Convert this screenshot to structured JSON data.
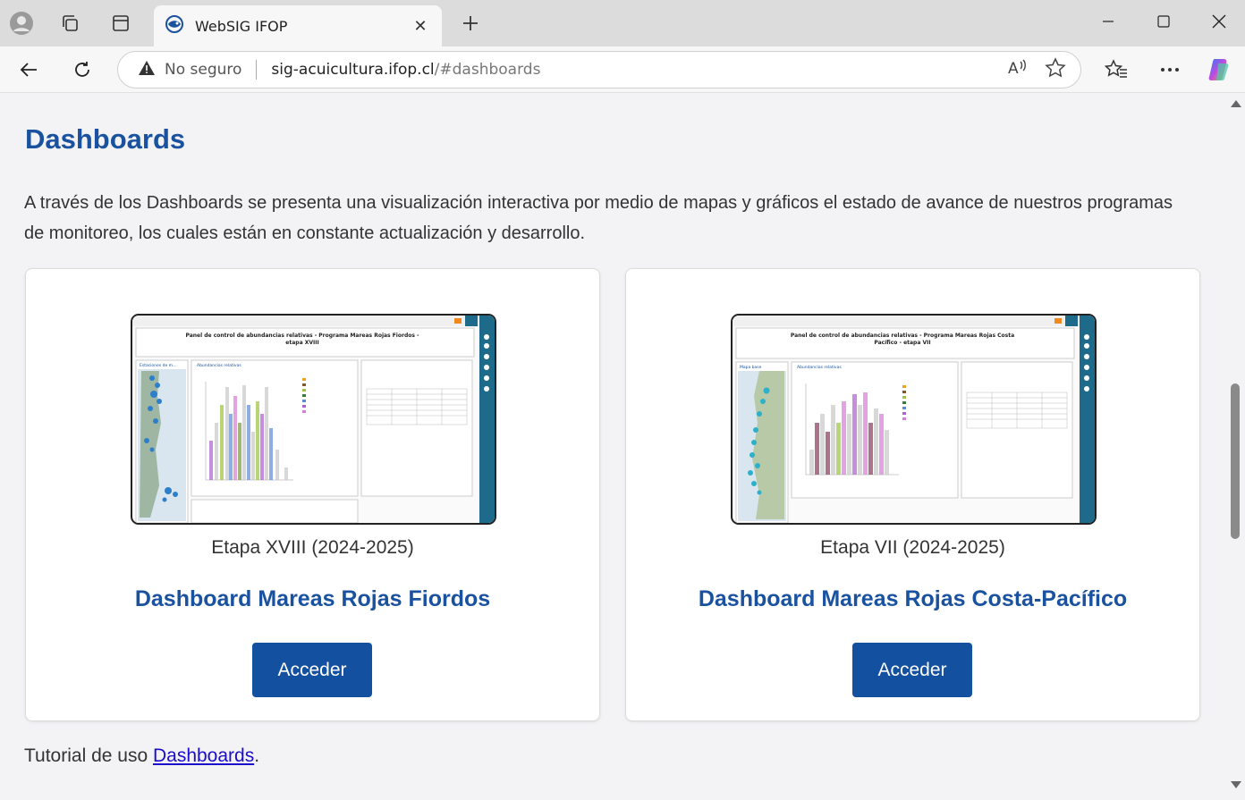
{
  "browser": {
    "tab": {
      "title": "WebSIG IFOP",
      "close": "✕"
    },
    "new_tab": "+",
    "window": {
      "minimize": "—",
      "maximize": "☐",
      "close": "✕"
    },
    "address": {
      "security_label": "No seguro",
      "host": "sig-acuicultura.ifop.cl",
      "path": "/#dashboards"
    },
    "icons": [
      "profile-icon",
      "workspaces-icon",
      "tab-actions-icon",
      "back-icon",
      "refresh-icon",
      "warning-icon",
      "read-aloud-icon",
      "favorite-icon",
      "favorites-icon",
      "more-icon",
      "copilot-icon"
    ]
  },
  "page": {
    "heading": "Dashboards",
    "intro": "A través de los Dashboards se presenta una visualización interactiva por medio de mapas y gráficos el estado de avance de nuestros programas de monitoreo, los cuales están en constante actualización y desarrollo.",
    "cards": [
      {
        "thumb_title": "Panel de control de abundancias relativas - Programa Mareas Rojas Fiordos - etapa XVIII",
        "map_label": "Estaciones de m...",
        "chart_label": "Abundancias relativas",
        "stage": "Etapa XVIII (2024-2025)",
        "title": "Dashboard Mareas Rojas Fiordos",
        "button": "Acceder"
      },
      {
        "thumb_title": "Panel de control de abundancias relativas - Programa Mareas Rojas Costa Pacífico - etapa VII",
        "map_label": "Mapa base",
        "chart_label": "Abundancias relativas",
        "stage": "Etapa VII (2024-2025)",
        "title": "Dashboard Mareas Rojas Costa-Pacífico",
        "button": "Acceder"
      }
    ],
    "tutorial_prefix": "Tutorial de uso ",
    "tutorial_link": "Dashboards",
    "tutorial_suffix": "."
  },
  "colors": {
    "accent": "#1a52a0",
    "button": "#1450a0",
    "link": "#1a0dcc"
  }
}
